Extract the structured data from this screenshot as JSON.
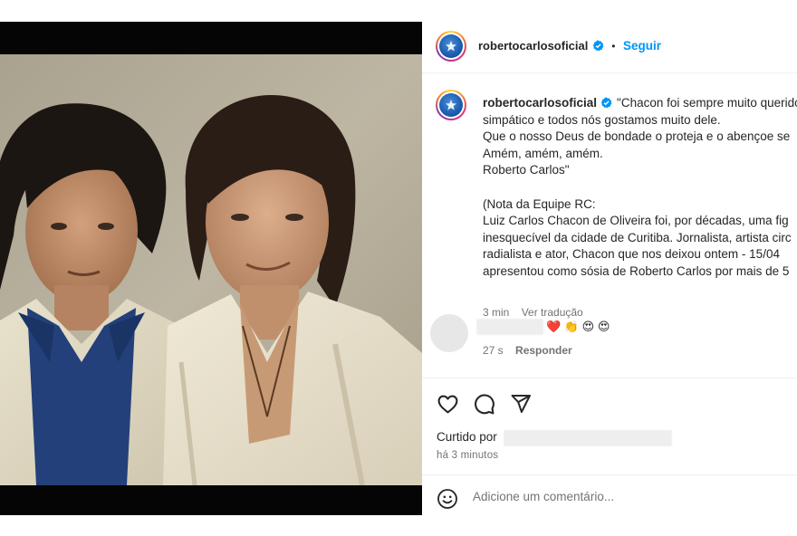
{
  "post": {
    "photo_alt": "",
    "author": "robertocarlosoficial",
    "verified_icon": "verified-badge-icon",
    "follow_label": "Seguir",
    "separator": "•"
  },
  "caption": {
    "username": "robertocarlosoficial",
    "lines": [
      "\"Chacon foi sempre muito querido",
      "simpático e todos nós gostamos muito dele.",
      "Que o nosso Deus de bondade o proteja e o abençoe se",
      "Amém, amém, amém.",
      "Roberto Carlos\"",
      "",
      "(Nota da Equipe RC:",
      "Luiz Carlos Chacon de Oliveira foi, por décadas, uma fig",
      "inesquecível da cidade de Curitiba. Jornalista, artista circ",
      "radialista e ator, Chacon que nos deixou ontem - 15/04",
      "apresentou como sósia de Roberto Carlos por mais de 5"
    ],
    "time": "3 min",
    "translate_label": "Ver tradução"
  },
  "comment": {
    "reactions": [
      "❤️",
      "👏",
      "😍",
      "😍"
    ],
    "time": "27 s",
    "reply_label": "Responder"
  },
  "actions": {
    "like_icon": "heart-icon",
    "comment_icon": "comment-icon",
    "share_icon": "share-icon"
  },
  "likes": {
    "liked_by_label": "Curtido por",
    "time_ago": "há 3 minutos"
  },
  "composer": {
    "emoji_icon": "emoji-icon",
    "placeholder": "Adicione um comentário..."
  },
  "colors": {
    "accent": "#0095f6",
    "muted": "#737373",
    "text": "#262626",
    "border": "#efefef"
  }
}
